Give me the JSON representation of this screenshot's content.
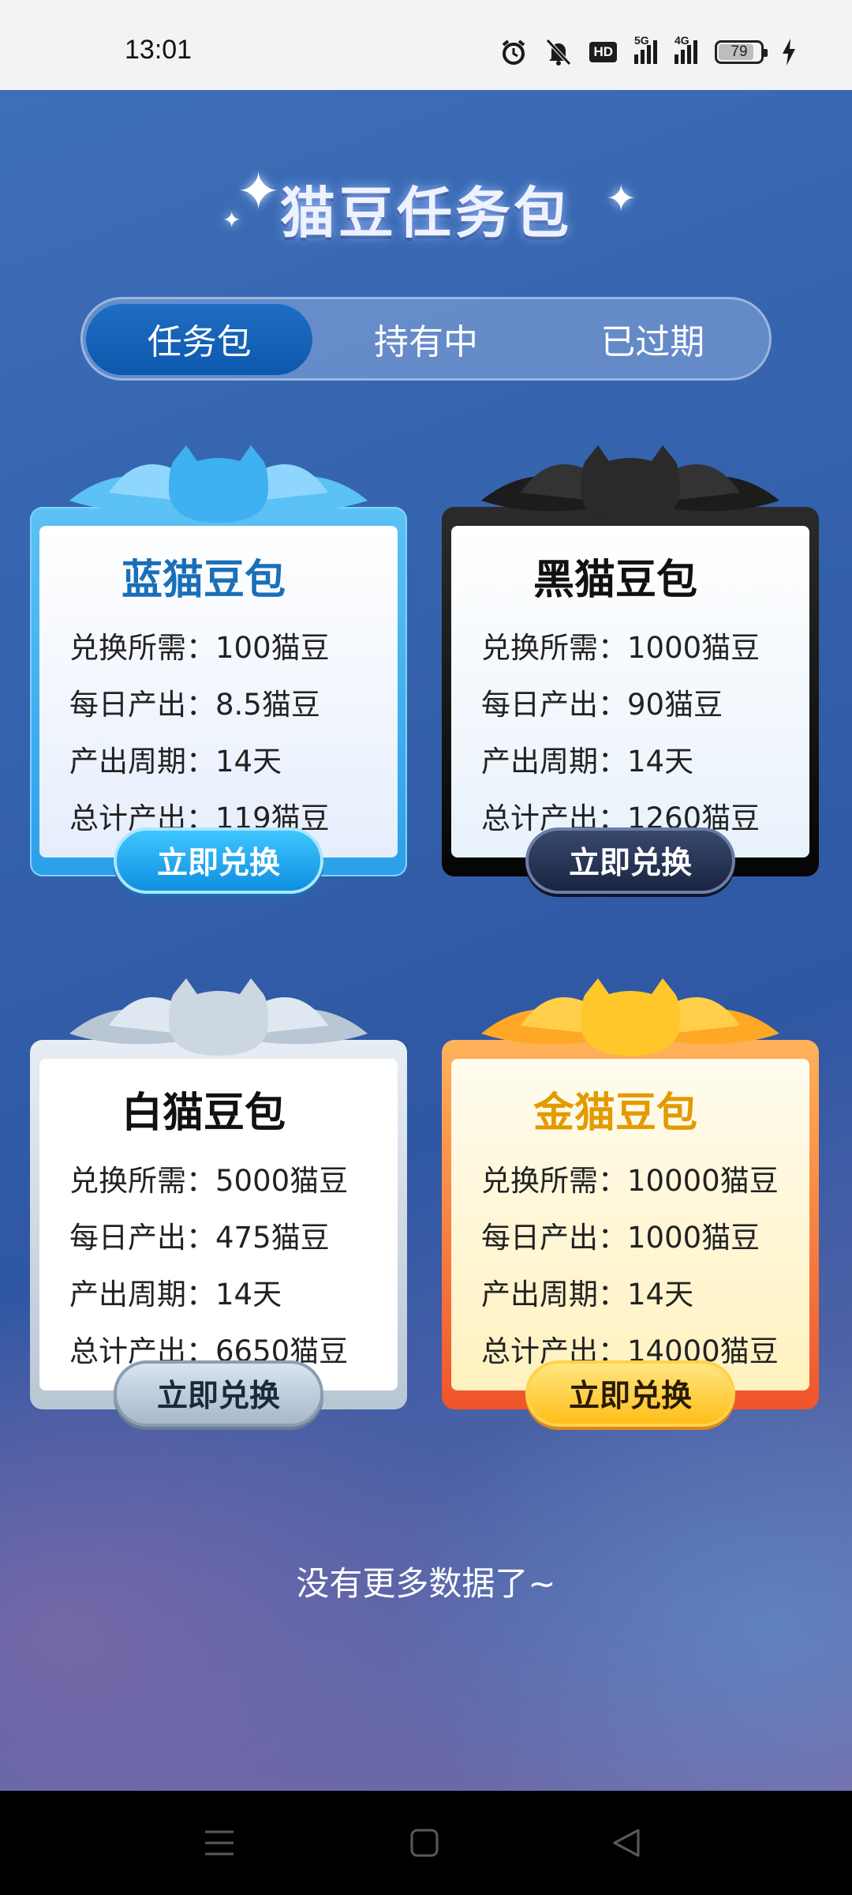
{
  "status_bar": {
    "time": "13:01",
    "icons": [
      "alarm-icon",
      "mute-bell-icon",
      "hd-voice-icon",
      "5g-signal-icon",
      "4g-signal-icon",
      "battery-icon",
      "charging-icon"
    ],
    "hd_label": "HD",
    "net_5g": "5G",
    "net_4g": "4G",
    "battery_level": "79"
  },
  "header": {
    "title": "猫豆任务包"
  },
  "tabs": [
    {
      "label": "任务包",
      "active": true
    },
    {
      "label": "持有中",
      "active": false
    },
    {
      "label": "已过期",
      "active": false
    }
  ],
  "cards": [
    {
      "title": "蓝猫豆包",
      "lines": [
        "兑换所需：100猫豆",
        "每日产出：8.5猫豆",
        "产出周期：14天",
        "总计产出：119猫豆"
      ],
      "button": "立即兑换",
      "accent": "#2ba0e8"
    },
    {
      "title": "黑猫豆包",
      "lines": [
        "兑换所需：1000猫豆",
        "每日产出：90猫豆",
        "产出周期：14天",
        "总计产出：1260猫豆"
      ],
      "button": "立即兑换",
      "accent": "#111111"
    },
    {
      "title": "白猫豆包",
      "lines": [
        "兑换所需：5000猫豆",
        "每日产出：475猫豆",
        "产出周期：14天",
        "总计产出：6650猫豆"
      ],
      "button": "立即兑换",
      "accent": "#b9c6d4"
    },
    {
      "title": "金猫豆包",
      "lines": [
        "兑换所需：10000猫豆",
        "每日产出：1000猫豆",
        "产出周期：14天",
        "总计产出：14000猫豆"
      ],
      "button": "立即兑换",
      "accent": "#ffbe1a"
    }
  ],
  "footer": {
    "no_more": "没有更多数据了~"
  },
  "nav_bar": {
    "buttons": [
      "menu-icon",
      "home-icon",
      "back-icon"
    ]
  }
}
